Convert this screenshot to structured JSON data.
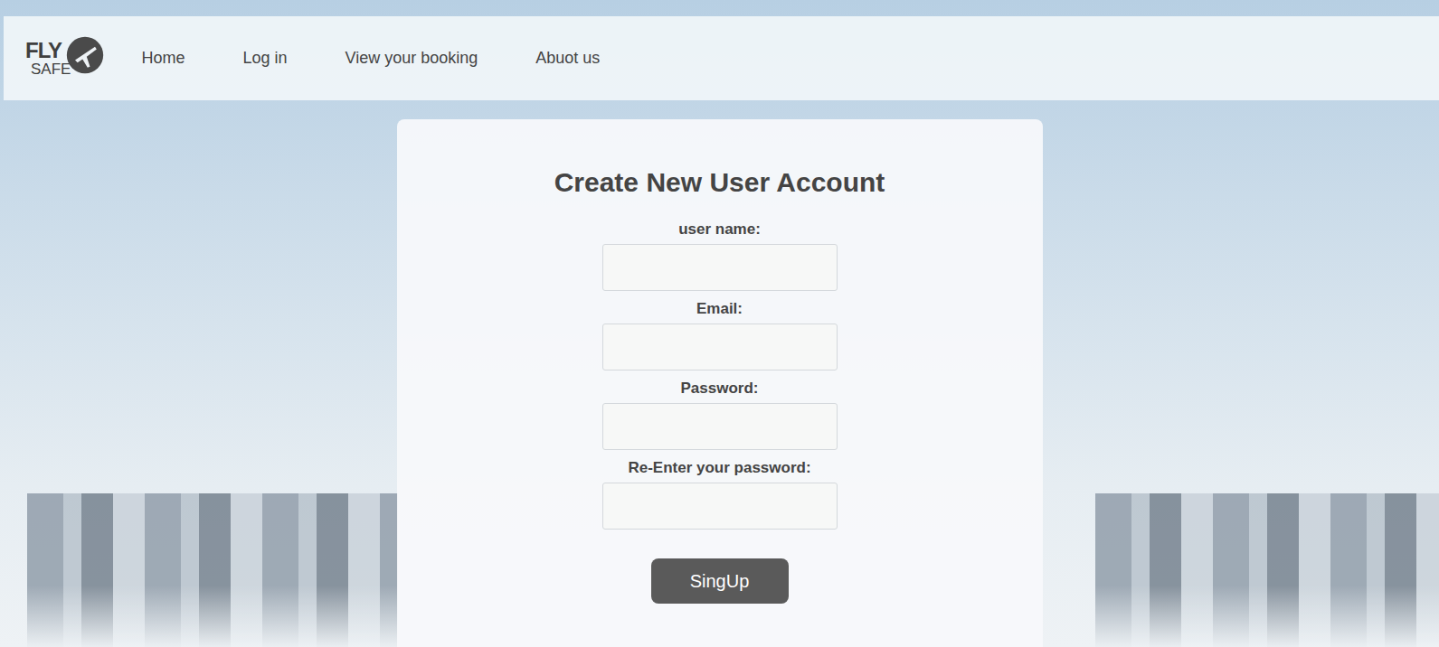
{
  "logo": {
    "top": "FLY",
    "bottom": "SAFE"
  },
  "nav": [
    {
      "label": "Home"
    },
    {
      "label": "Log in"
    },
    {
      "label": "View your booking"
    },
    {
      "label": "Abuot us"
    }
  ],
  "form": {
    "title": "Create New User Account",
    "fields": [
      {
        "label": "user name:",
        "value": ""
      },
      {
        "label": "Email:",
        "value": ""
      },
      {
        "label": "Password:",
        "value": ""
      },
      {
        "label": "Re-Enter your password:",
        "value": ""
      }
    ],
    "button": "SingUp"
  }
}
